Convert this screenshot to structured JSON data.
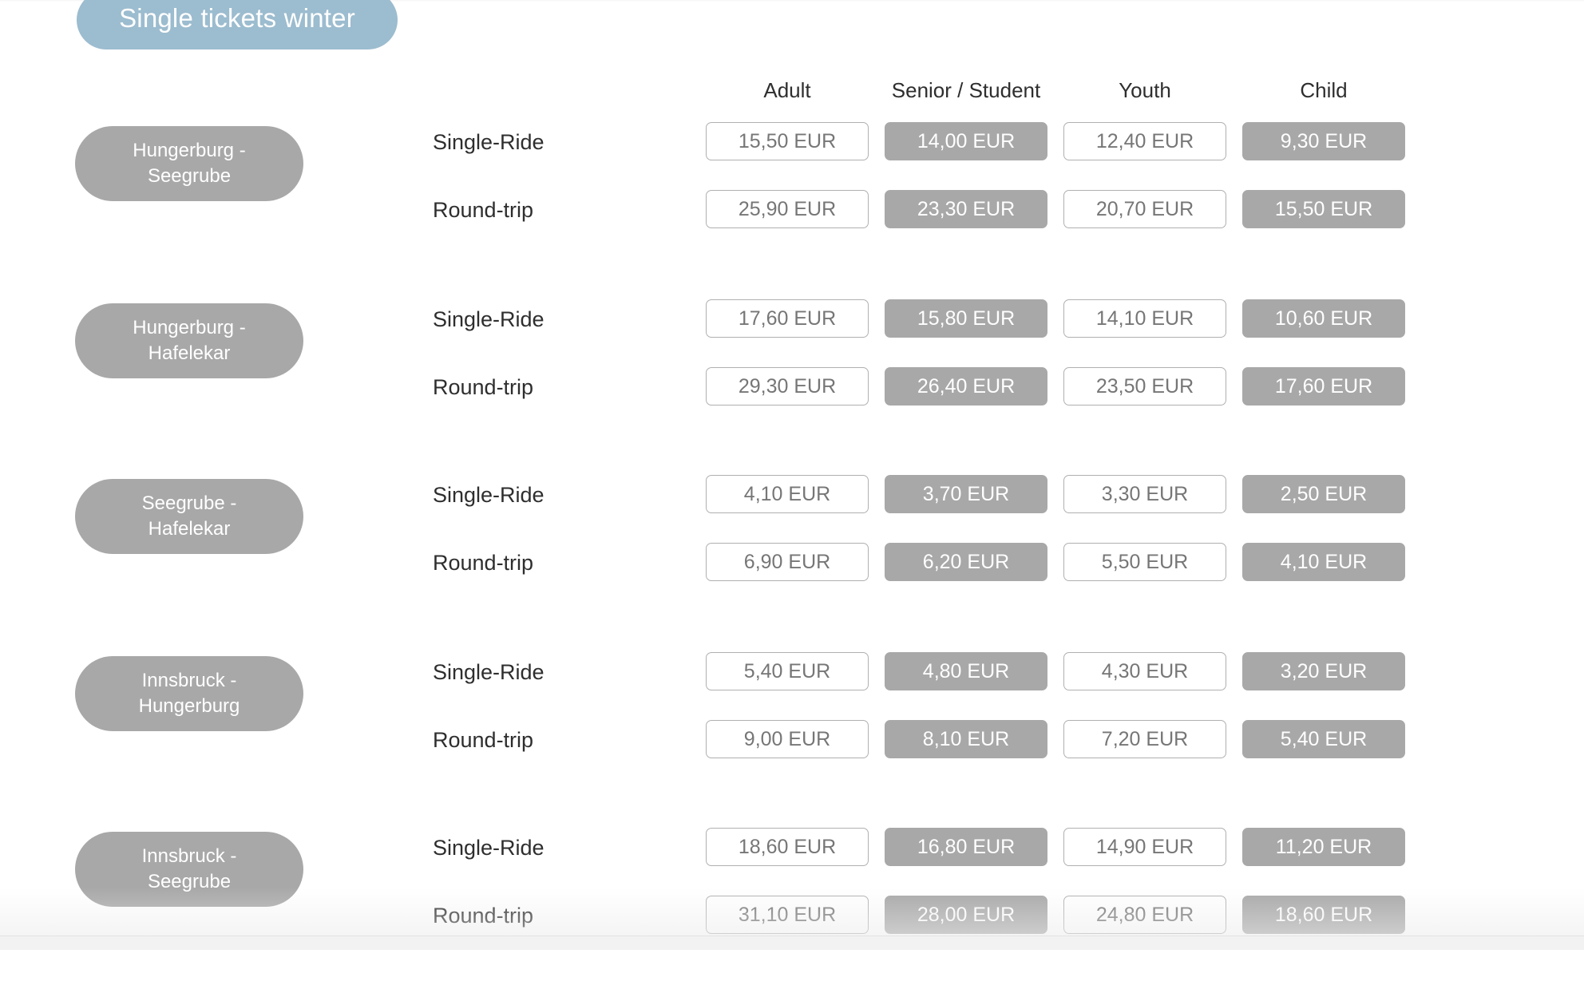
{
  "header": {
    "title": "Single tickets winter",
    "title_badge_color": "#9cbccf"
  },
  "colors": {
    "accent": "#9cbccf",
    "pill_gray": "#a8a8a8",
    "light_pill_border": "#b0b0b0",
    "light_pill_text": "#767676",
    "text": "#2e2e2e"
  },
  "table": {
    "columns": [
      {
        "label": "Adult",
        "style": "light"
      },
      {
        "label": "Senior / Student",
        "style": "dark"
      },
      {
        "label": "Youth",
        "style": "light"
      },
      {
        "label": "Child",
        "style": "dark"
      }
    ],
    "ticket_types": [
      "Single-Ride",
      "Round-trip"
    ],
    "currency": "EUR",
    "groups": [
      {
        "route_line1": "Hungerburg -",
        "route_line2": "Seegrube",
        "rows": [
          {
            "type": "Single-Ride",
            "prices": [
              "15,50 EUR",
              "14,00 EUR",
              "12,40 EUR",
              "9,30 EUR"
            ]
          },
          {
            "type": "Round-trip",
            "prices": [
              "25,90 EUR",
              "23,30 EUR",
              "20,70 EUR",
              "15,50 EUR"
            ]
          }
        ]
      },
      {
        "route_line1": "Hungerburg -",
        "route_line2": "Hafelekar",
        "rows": [
          {
            "type": "Single-Ride",
            "prices": [
              "17,60 EUR",
              "15,80 EUR",
              "14,10 EUR",
              "10,60 EUR"
            ]
          },
          {
            "type": "Round-trip",
            "prices": [
              "29,30 EUR",
              "26,40 EUR",
              "23,50 EUR",
              "17,60 EUR"
            ]
          }
        ]
      },
      {
        "route_line1": "Seegrube -",
        "route_line2": "Hafelekar",
        "rows": [
          {
            "type": "Single-Ride",
            "prices": [
              "4,10 EUR",
              "3,70 EUR",
              "3,30 EUR",
              "2,50 EUR"
            ]
          },
          {
            "type": "Round-trip",
            "prices": [
              "6,90 EUR",
              "6,20 EUR",
              "5,50 EUR",
              "4,10 EUR"
            ]
          }
        ]
      },
      {
        "route_line1": "Innsbruck -",
        "route_line2": "Hungerburg",
        "rows": [
          {
            "type": "Single-Ride",
            "prices": [
              "5,40 EUR",
              "4,80 EUR",
              "4,30 EUR",
              "3,20 EUR"
            ]
          },
          {
            "type": "Round-trip",
            "prices": [
              "9,00 EUR",
              "8,10 EUR",
              "7,20 EUR",
              "5,40 EUR"
            ]
          }
        ]
      },
      {
        "route_line1": "Innsbruck -",
        "route_line2": "Seegrube",
        "rows": [
          {
            "type": "Single-Ride",
            "prices": [
              "18,60 EUR",
              "16,80 EUR",
              "14,90 EUR",
              "11,20 EUR"
            ]
          },
          {
            "type": "Round-trip",
            "prices": [
              "31,10 EUR",
              "28,00 EUR",
              "24,80 EUR",
              "18,60 EUR"
            ]
          }
        ]
      }
    ]
  }
}
